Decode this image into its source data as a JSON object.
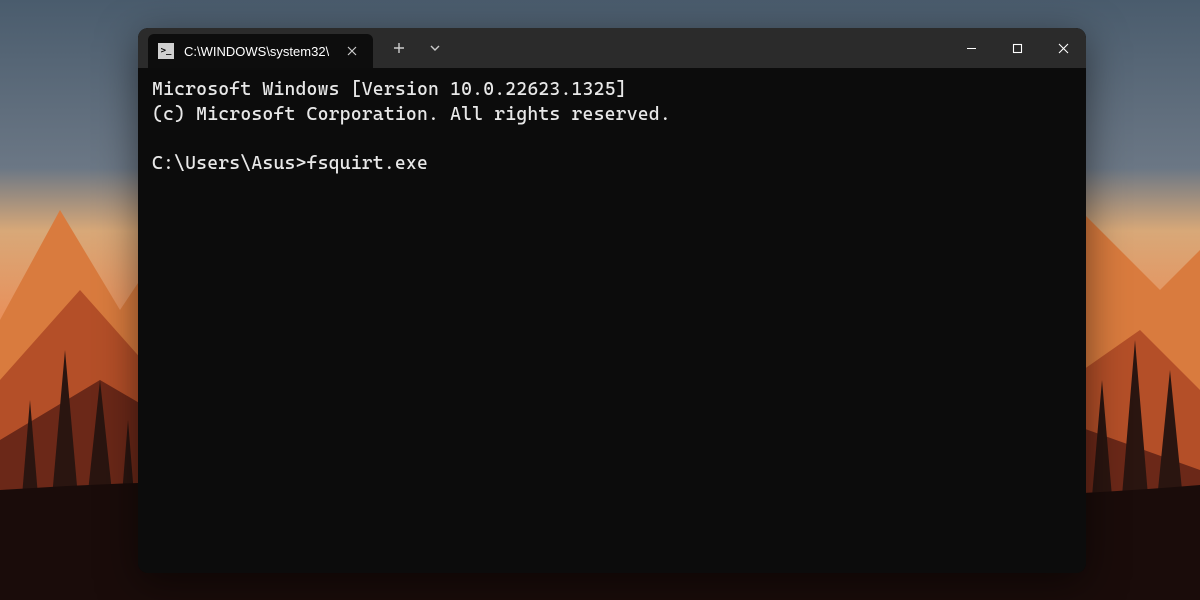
{
  "tab": {
    "title": "C:\\WINDOWS\\system32\\"
  },
  "output": {
    "line1": "Microsoft Windows [Version 10.0.22623.1325]",
    "line2": "(c) Microsoft Corporation. All rights reserved."
  },
  "prompt": {
    "path": "C:\\Users\\Asus>",
    "command": "fsquirt.exe"
  }
}
